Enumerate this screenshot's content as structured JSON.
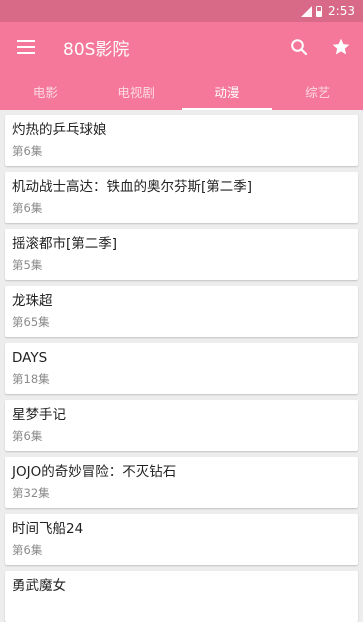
{
  "status_bar": {
    "time": "2:53"
  },
  "app_bar": {
    "title": "80S影院",
    "menu_icon": "menu-icon",
    "search_icon": "search-icon",
    "favorite_icon": "star-icon"
  },
  "tabs": [
    {
      "label": "电影",
      "active": false
    },
    {
      "label": "电视剧",
      "active": false
    },
    {
      "label": "动漫",
      "active": true
    },
    {
      "label": "综艺",
      "active": false
    }
  ],
  "items": [
    {
      "title": "灼热的乒乓球娘",
      "episodes": "第6集"
    },
    {
      "title": "机动战士高达：铁血的奥尔芬斯[第二季]",
      "episodes": "第6集"
    },
    {
      "title": "摇滚都市[第二季]",
      "episodes": "第5集"
    },
    {
      "title": "龙珠超",
      "episodes": "第65集"
    },
    {
      "title": "DAYS",
      "episodes": "第18集"
    },
    {
      "title": "星梦手记",
      "episodes": "第6集"
    },
    {
      "title": "JOJO的奇妙冒险：不灭钻石",
      "episodes": "第32集"
    },
    {
      "title": "时间飞船24",
      "episodes": "第6集"
    },
    {
      "title": "勇武魔女",
      "episodes": ""
    }
  ],
  "colors": {
    "status_bar": "#d86a88",
    "primary": "#f5789a",
    "background": "#ededed"
  }
}
